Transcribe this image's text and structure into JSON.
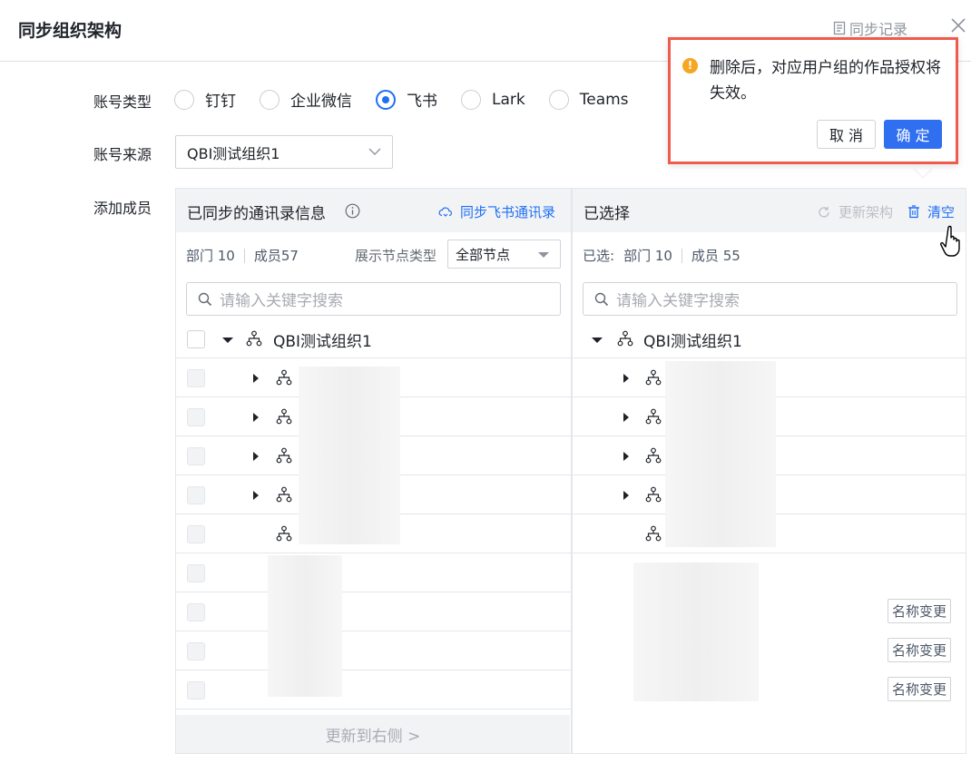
{
  "dialog": {
    "title": "同步组织架构",
    "sync_record_label": "同步记录"
  },
  "form": {
    "account_type_label": "账号类型",
    "account_types": [
      {
        "label": "钉钉",
        "checked": false
      },
      {
        "label": "企业微信",
        "checked": false
      },
      {
        "label": "飞书",
        "checked": true
      },
      {
        "label": "Lark",
        "checked": false
      },
      {
        "label": "Teams",
        "checked": false
      }
    ],
    "account_source_label": "账号来源",
    "account_source_value": "QBI测试组织1",
    "add_members_label": "添加成员"
  },
  "left_panel": {
    "title": "已同步的通讯录信息",
    "sync_link": "同步飞书通讯录",
    "dept_stat": "部门 10",
    "member_stat": "成员57",
    "node_type_label": "展示节点类型",
    "node_type_value": "全部节点",
    "search_placeholder": "请输入关键字搜索",
    "root_name": "QBI测试组织1",
    "bottom_button": "更新到右侧 >"
  },
  "right_panel": {
    "title": "已选择",
    "update_label": "更新架构",
    "clear_label": "清空",
    "selected_prefix": "已选:",
    "dept_stat": "部门 10",
    "member_stat": "成员 55",
    "search_placeholder": "请输入关键字搜索",
    "root_name": "QBI测试组织1",
    "rename_tag": "名称变更"
  },
  "popconfirm": {
    "message": "删除后，对应用户组的作品授权将失效。",
    "cancel_label": "取 消",
    "ok_label": "确 定"
  },
  "colors": {
    "accent": "#1f6ff5",
    "warning": "#f5a623",
    "highlight_border": "#ef5b4d"
  }
}
